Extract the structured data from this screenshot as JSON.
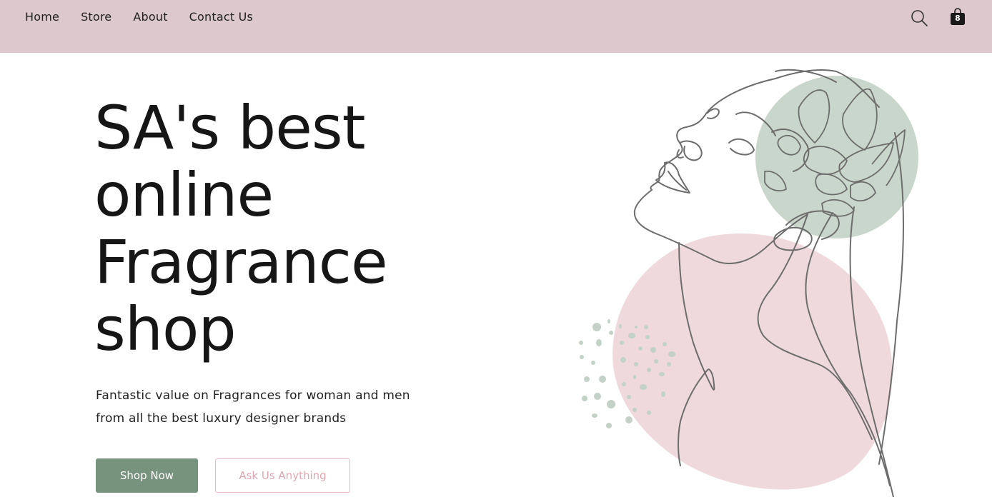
{
  "nav": {
    "items": [
      {
        "label": "Home"
      },
      {
        "label": "Store"
      },
      {
        "label": "About"
      },
      {
        "label": "Contact Us"
      }
    ]
  },
  "header": {
    "search_icon": "search-icon",
    "cart_icon": "shopping-bag-icon",
    "cart_count": "8"
  },
  "hero": {
    "title_lines": [
      "SA's best",
      "online",
      "Fragrance",
      "shop"
    ],
    "subtitle_lines": [
      "Fantastic value on Fragrances for woman and men",
      "from all the best luxury designer brands"
    ],
    "primary_button": "Shop Now",
    "secondary_button": "Ask Us Anything"
  },
  "colors": {
    "topbar": "#dcc8cd",
    "primary_green": "#78937d",
    "pink_accent": "#e8b8c0",
    "sage_circle": "#c8d6cc",
    "pink_blob": "#efd9dc"
  }
}
